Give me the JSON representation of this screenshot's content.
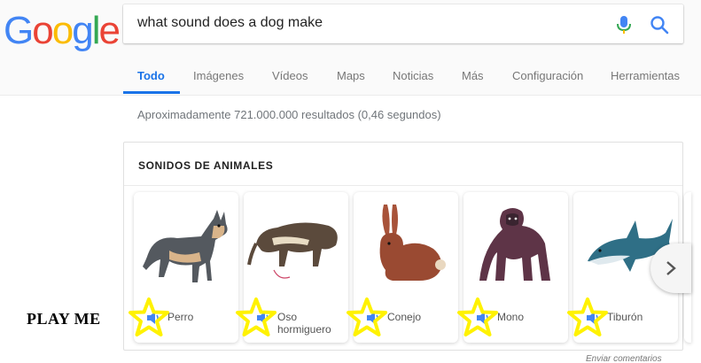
{
  "logo": {
    "letters": [
      "G",
      "o",
      "o",
      "g",
      "l",
      "e"
    ],
    "colors": [
      "#4285F4",
      "#EA4335",
      "#FBBC05",
      "#4285F4",
      "#34A853",
      "#EA4335"
    ]
  },
  "search": {
    "query": "what sound does a dog make",
    "mic_icon": "microphone-icon",
    "search_icon": "search-icon"
  },
  "tabs": {
    "items": [
      {
        "label": "Todo",
        "active": true
      },
      {
        "label": "Imágenes",
        "active": false
      },
      {
        "label": "Vídeos",
        "active": false
      },
      {
        "label": "Maps",
        "active": false
      },
      {
        "label": "Noticias",
        "active": false
      },
      {
        "label": "Más",
        "active": false
      },
      {
        "label": "Configuración",
        "active": false
      },
      {
        "label": "Herramientas",
        "active": false
      }
    ]
  },
  "result_stats": "Aproximadamente 721.000.000 resultados (0,46 segundos)",
  "card": {
    "title": "SONIDOS DE ANIMALES",
    "animals": [
      {
        "label": "Perro",
        "icon": "speaker-icon"
      },
      {
        "label": "Oso hormiguero",
        "icon": "speaker-icon"
      },
      {
        "label": "Conejo",
        "icon": "speaker-icon"
      },
      {
        "label": "Mono",
        "icon": "speaker-icon"
      },
      {
        "label": "Tiburón",
        "icon": "speaker-icon"
      }
    ],
    "next_icon": "chevron-right-icon"
  },
  "annotation": {
    "label": "PLAY ME",
    "star_color": "#FFF200"
  },
  "feedback": "Enviar comentarios",
  "colors": {
    "accent": "#1a73e8",
    "speaker": "#4285F4"
  }
}
